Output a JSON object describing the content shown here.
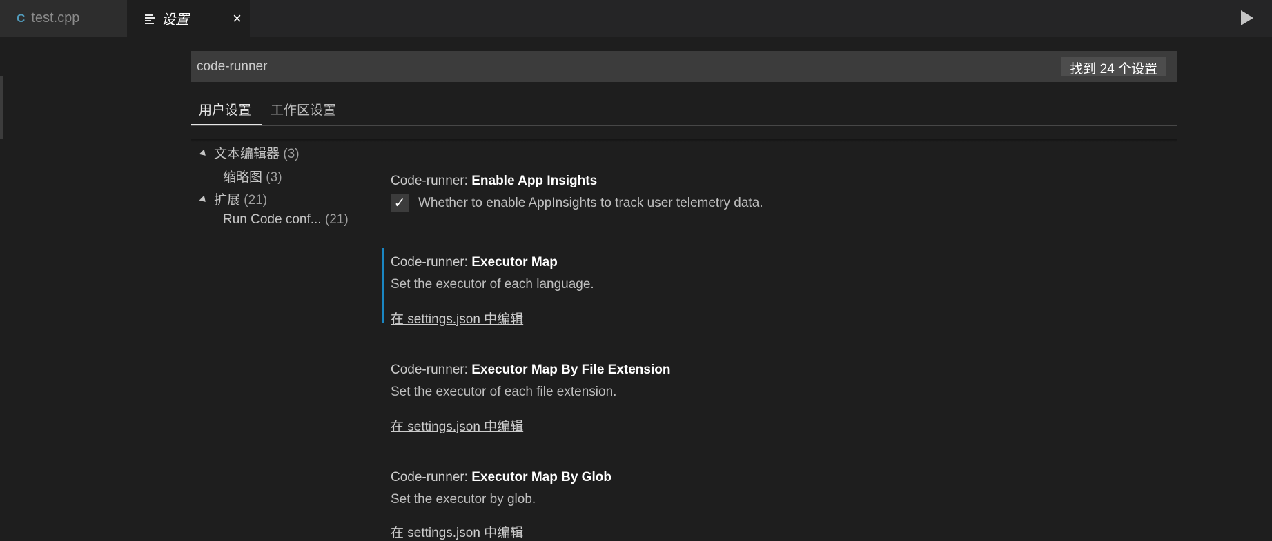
{
  "tabs": [
    {
      "label": "test.cpp",
      "icon": "cpp-file-icon"
    },
    {
      "label": "设置",
      "icon": "settings-lines-icon",
      "close": "×"
    }
  ],
  "search": {
    "value": "code-runner",
    "count_label": "找到 24 个设置"
  },
  "scope_tabs": {
    "user": "用户设置",
    "workspace": "工作区设置"
  },
  "toc": [
    {
      "label": "文本编辑器",
      "count": "(3)"
    },
    {
      "label": "缩略图",
      "count": "(3)"
    },
    {
      "label": "扩展",
      "count": "(21)"
    },
    {
      "label": "Run Code conf...",
      "count": "(21)"
    }
  ],
  "settings": [
    {
      "prefix": "Code-runner: ",
      "name": "Enable App Insights",
      "desc": "Whether to enable AppInsights to track user telemetry data.",
      "checked": true
    },
    {
      "prefix": "Code-runner: ",
      "name": "Executor Map",
      "desc": "Set the executor of each language.",
      "link": "在 settings.json 中编辑"
    },
    {
      "prefix": "Code-runner: ",
      "name": "Executor Map By File Extension",
      "desc": "Set the executor of each file extension.",
      "link": "在 settings.json 中编辑"
    },
    {
      "prefix": "Code-runner: ",
      "name": "Executor Map By Glob",
      "desc": "Set the executor by glob.",
      "link": "在 settings.json 中编辑"
    }
  ],
  "colors": {
    "accent": "#1a86c2",
    "background": "#1e1e1e",
    "tabbar": "#252526"
  }
}
